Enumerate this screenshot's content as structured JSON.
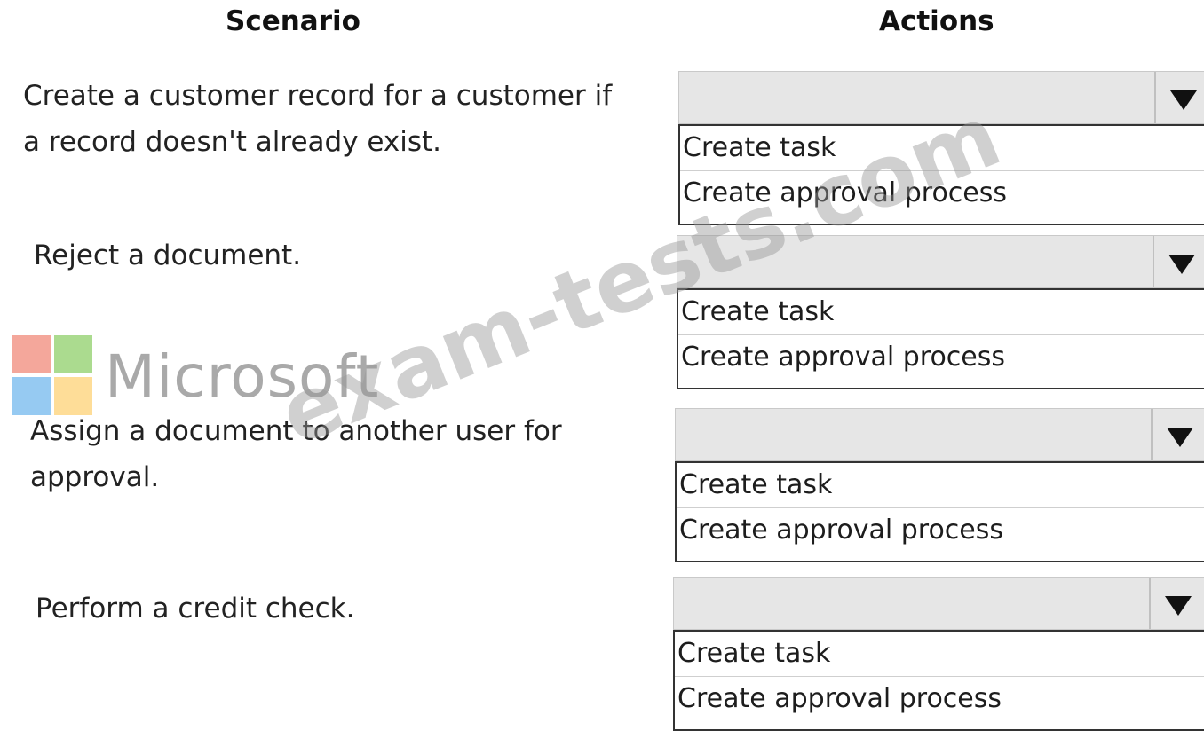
{
  "headers": {
    "scenario": "Scenario",
    "actions": "Actions"
  },
  "rows": [
    {
      "scenario": "Create a customer record for a customer if\na record doesn't already exist.",
      "selected": "",
      "options": [
        "Create task",
        "Create approval process"
      ]
    },
    {
      "scenario": "Reject a document.",
      "selected": "",
      "options": [
        "Create task",
        "Create approval process"
      ]
    },
    {
      "scenario": "Assign a document to another user for\napproval.",
      "selected": "",
      "options": [
        "Create task",
        "Create approval process"
      ]
    },
    {
      "scenario": "Perform a credit check.",
      "selected": "",
      "options": [
        "Create task",
        "Create approval process"
      ]
    }
  ],
  "watermark": {
    "brand": "Microsoft",
    "site": "exam-tests.com"
  },
  "icons": {
    "dropdown": "triangle-down-icon",
    "logo": "microsoft-logo-icon"
  }
}
